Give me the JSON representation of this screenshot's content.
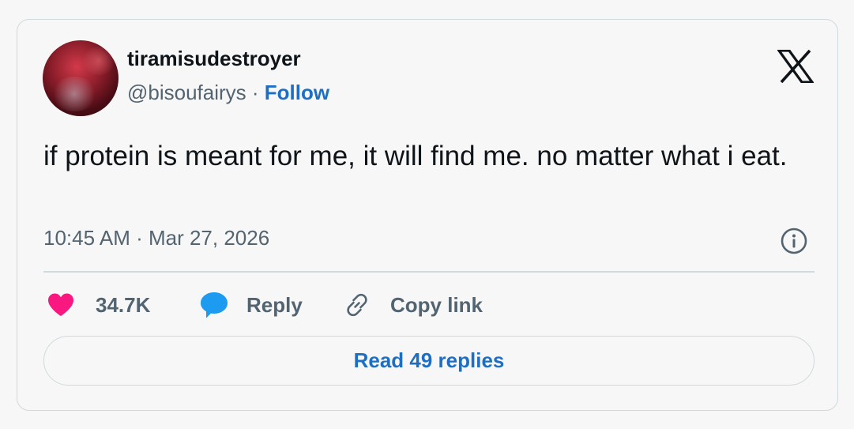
{
  "author": {
    "display_name": "tiramisudestroyer",
    "handle": "@bisoufairys",
    "separator": " · ",
    "follow_label": "Follow"
  },
  "tweet": {
    "text": "if protein is meant for me, it will find me. no matter what i eat.",
    "timestamp": "10:45 AM · Mar 27, 2026"
  },
  "actions": {
    "like_count": "34.7K",
    "reply_label": "Reply",
    "copy_link_label": "Copy link"
  },
  "read_replies_label": "Read 49 replies",
  "icons": {
    "brand": "x-logo-icon",
    "info": "info-icon",
    "like": "heart-icon",
    "reply": "speech-bubble-icon",
    "copy": "link-icon"
  },
  "colors": {
    "like": "#f91880",
    "reply": "#1d9bf0",
    "link": "#1d6fc4",
    "text": "#0f1419",
    "secondary": "#536471",
    "border": "#cfd9de"
  }
}
